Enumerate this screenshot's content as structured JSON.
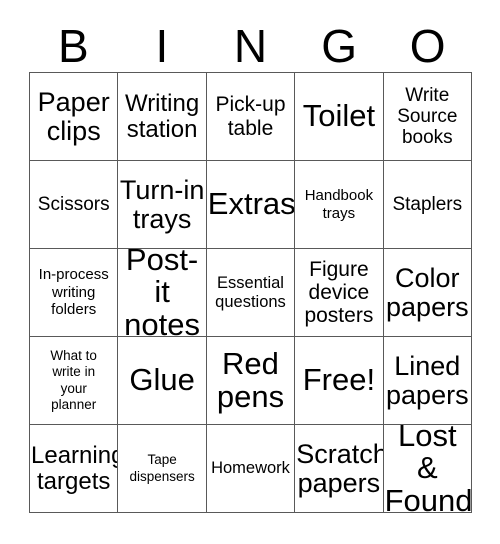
{
  "header": {
    "letters": [
      "B",
      "I",
      "N",
      "G",
      "O"
    ]
  },
  "grid": {
    "columns": 5,
    "rows": 5,
    "cells": [
      {
        "text": "Paper\nclips",
        "size": "fs-xl"
      },
      {
        "text": "Writing\nstation",
        "size": "fs-l"
      },
      {
        "text": "Pick-up\ntable",
        "size": "fs-ml"
      },
      {
        "text": "Toilet",
        "size": "fs-xxl"
      },
      {
        "text": "Write\nSource\nbooks",
        "size": "fs-m"
      },
      {
        "text": "Scissors",
        "size": "fs-m"
      },
      {
        "text": "Turn-in\ntrays",
        "size": "fs-xl"
      },
      {
        "text": "Extras",
        "size": "fs-xxl"
      },
      {
        "text": "Handbook\ntrays",
        "size": "fs-s"
      },
      {
        "text": "Staplers",
        "size": "fs-m"
      },
      {
        "text": "In-process\nwriting\nfolders",
        "size": "fs-s"
      },
      {
        "text": "Post-it\nnotes",
        "size": "fs-xxl"
      },
      {
        "text": "Essential\nquestions",
        "size": "fs-sm"
      },
      {
        "text": "Figure\ndevice\nposters",
        "size": "fs-ml"
      },
      {
        "text": "Color\npapers",
        "size": "fs-xl"
      },
      {
        "text": "What to\nwrite in\nyour\nplanner",
        "size": "fs-xs"
      },
      {
        "text": "Glue",
        "size": "fs-xxl"
      },
      {
        "text": "Red\npens",
        "size": "fs-xxl"
      },
      {
        "text": "Free!",
        "size": "fs-xxl"
      },
      {
        "text": "Lined\npapers",
        "size": "fs-xl"
      },
      {
        "text": "Learning\ntargets",
        "size": "fs-l"
      },
      {
        "text": "Tape\ndispensers",
        "size": "fs-xs"
      },
      {
        "text": "Homework",
        "size": "fs-sm"
      },
      {
        "text": "Scratch\npapers",
        "size": "fs-xl"
      },
      {
        "text": "Lost &\nFound",
        "size": "fs-xxl"
      }
    ]
  }
}
